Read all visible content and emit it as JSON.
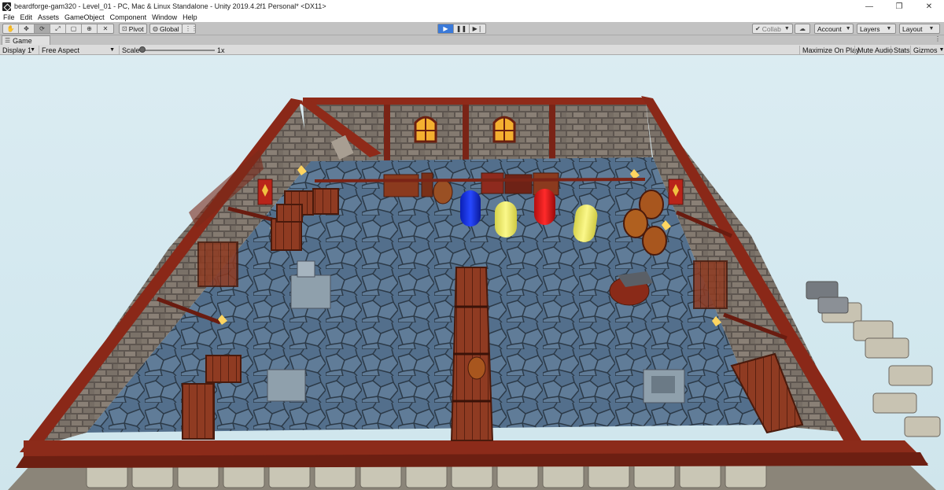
{
  "window": {
    "title": "beardforge-gam320 - Level_01 - PC, Mac & Linux Standalone - Unity 2019.4.2f1 Personal* <DX11>",
    "minimize": "—",
    "maximize": "❐",
    "close": "✕"
  },
  "menu": {
    "items": [
      "File",
      "Edit",
      "Assets",
      "GameObject",
      "Component",
      "Window",
      "Help"
    ]
  },
  "toolbar": {
    "tools": [
      "hand-tool",
      "move-tool",
      "rotate-tool",
      "scale-tool",
      "rect-tool",
      "transform-tool",
      "custom-tool"
    ],
    "pivot_label": "Pivot",
    "global_label": "Global",
    "collab_label": "Collab",
    "account_label": "Account",
    "layers_label": "Layers",
    "layout_label": "Layout"
  },
  "game_tab": {
    "label": "Game"
  },
  "game_bar": {
    "display": "Display 1",
    "aspect": "Free Aspect",
    "scale_label": "Scale",
    "scale_value": "1x",
    "scale_level": 0.0,
    "maximize_on_play": "Maximize On Play",
    "mute_audio": "Mute Audio",
    "stats": "Stats",
    "gizmos": "Gizmos"
  },
  "colors": {
    "play_accent": "#3a79d8",
    "floor": "#4f6a86",
    "wall_wood": "#8a2a1c",
    "stone": "#8c8378",
    "capsule_blue": "#1634e8",
    "capsule_yellow": "#f2ee6a",
    "capsule_red": "#e21717"
  }
}
